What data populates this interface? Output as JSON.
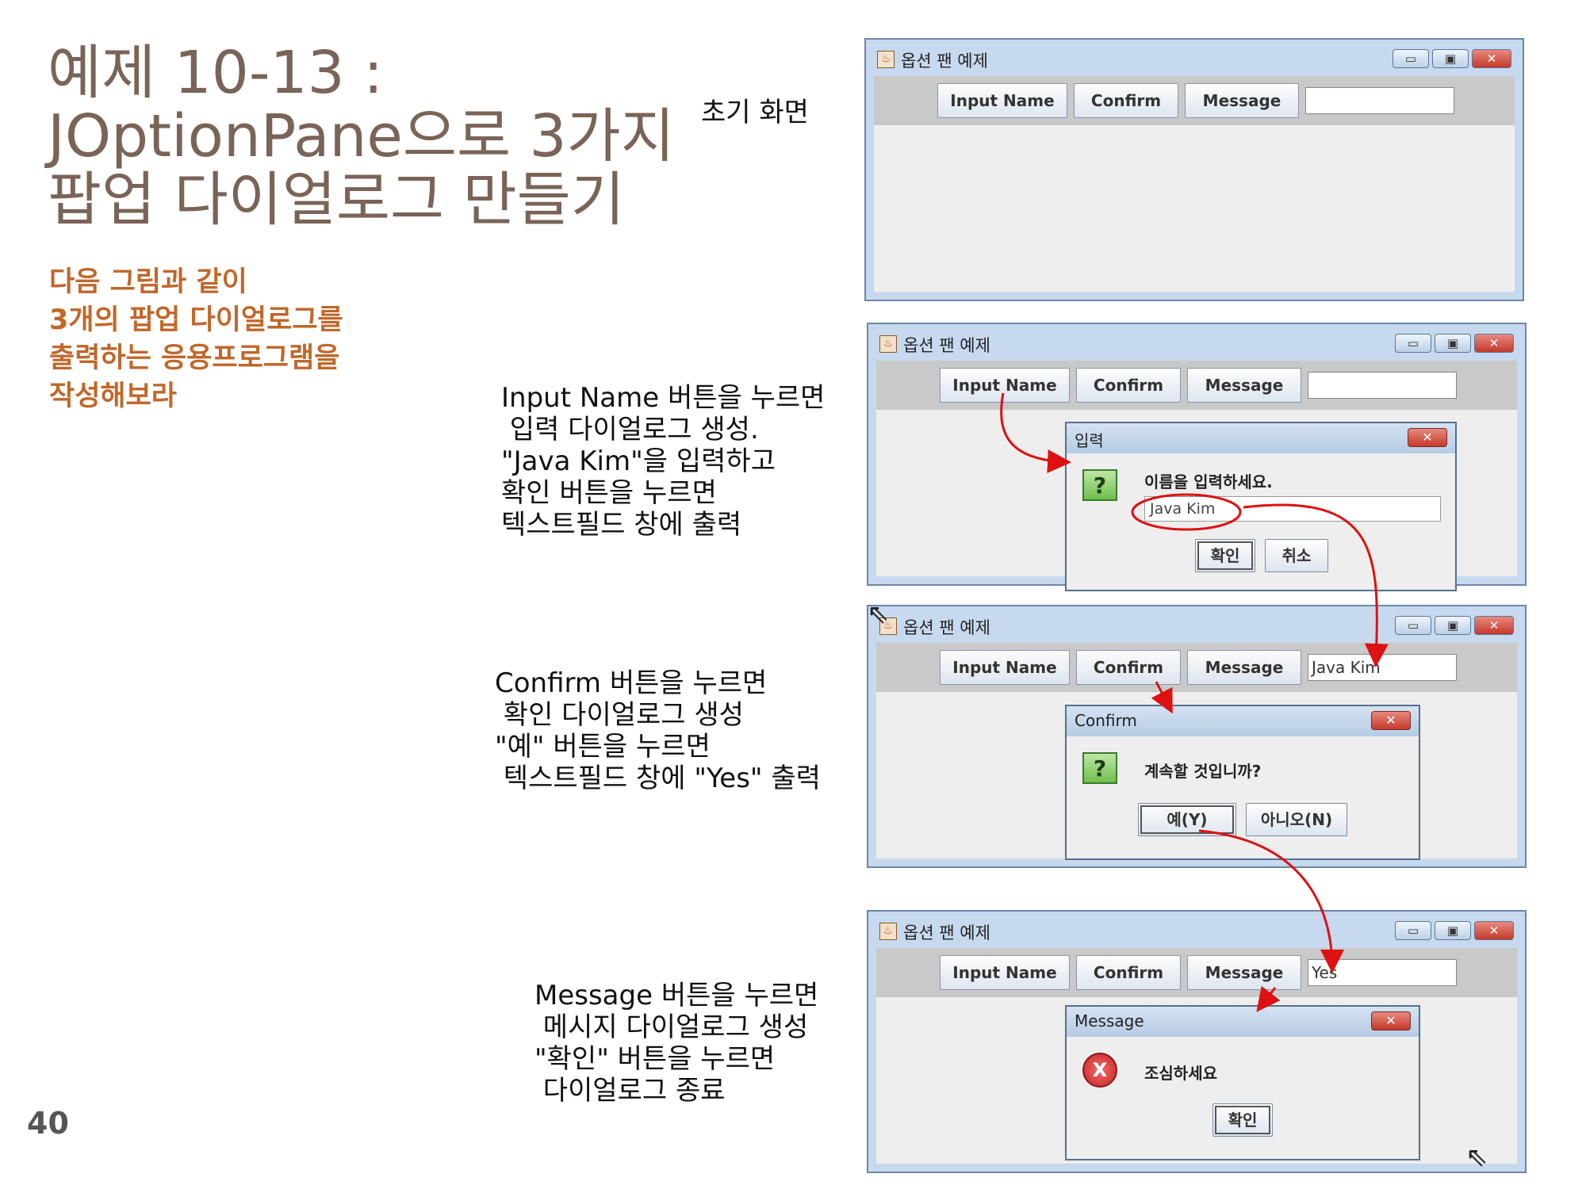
{
  "slide": {
    "title": "예제 10-13 :\nJOptionPane으로 3가지\n팝업 다이얼로그 만들기",
    "subtitle": "다음 그림과 같이\n3개의 팝업 다이얼로그를\n출력하는 응용프로그램을\n작성해보라",
    "page_number": "40"
  },
  "captions": {
    "initial": "초기 화면",
    "input": "Input Name 버튼을 누르면\n 입력 다이얼로그 생성.\n\"Java Kim\"을 입력하고\n확인 버튼을 누르면\n텍스트필드 창에 출력",
    "confirm": "Confirm 버튼을 누르면\n 확인 다이얼로그 생성\n\"예\" 버튼을 누르면\n 텍스트필드 창에 \"Yes\" 출력",
    "message": "Message 버튼을 누르면\n 메시지 다이얼로그 생성\n\"확인\" 버튼을 누르면\n 다이얼로그 종료"
  },
  "window": {
    "title": "옵션 팬 예제",
    "buttons": {
      "input_name": "Input Name",
      "confirm": "Confirm",
      "message": "Message"
    },
    "controls": {
      "minimize": "▭",
      "maximize": "▣",
      "close": "✕"
    }
  },
  "screens": {
    "s1": {
      "field": ""
    },
    "s2": {
      "field": ""
    },
    "s3": {
      "field": "Java Kim"
    },
    "s4": {
      "field": "Yes"
    }
  },
  "dialogs": {
    "input": {
      "title": "입력",
      "icon": "?",
      "prompt": "이름을 입력하세요.",
      "value": "Java Kim",
      "ok": "확인",
      "cancel": "취소",
      "close": "✕"
    },
    "confirm": {
      "title": "Confirm",
      "icon": "?",
      "prompt": "계속할 것입니까?",
      "yes": "예(Y)",
      "no": "아니오(N)",
      "close": "✕"
    },
    "message": {
      "title": "Message",
      "icon": "X",
      "prompt": "조심하세요",
      "ok": "확인",
      "close": "✕"
    }
  },
  "colors": {
    "annotation_arrow": "#dd1111",
    "title": "#7a6457",
    "subtitle": "#c0672a"
  }
}
